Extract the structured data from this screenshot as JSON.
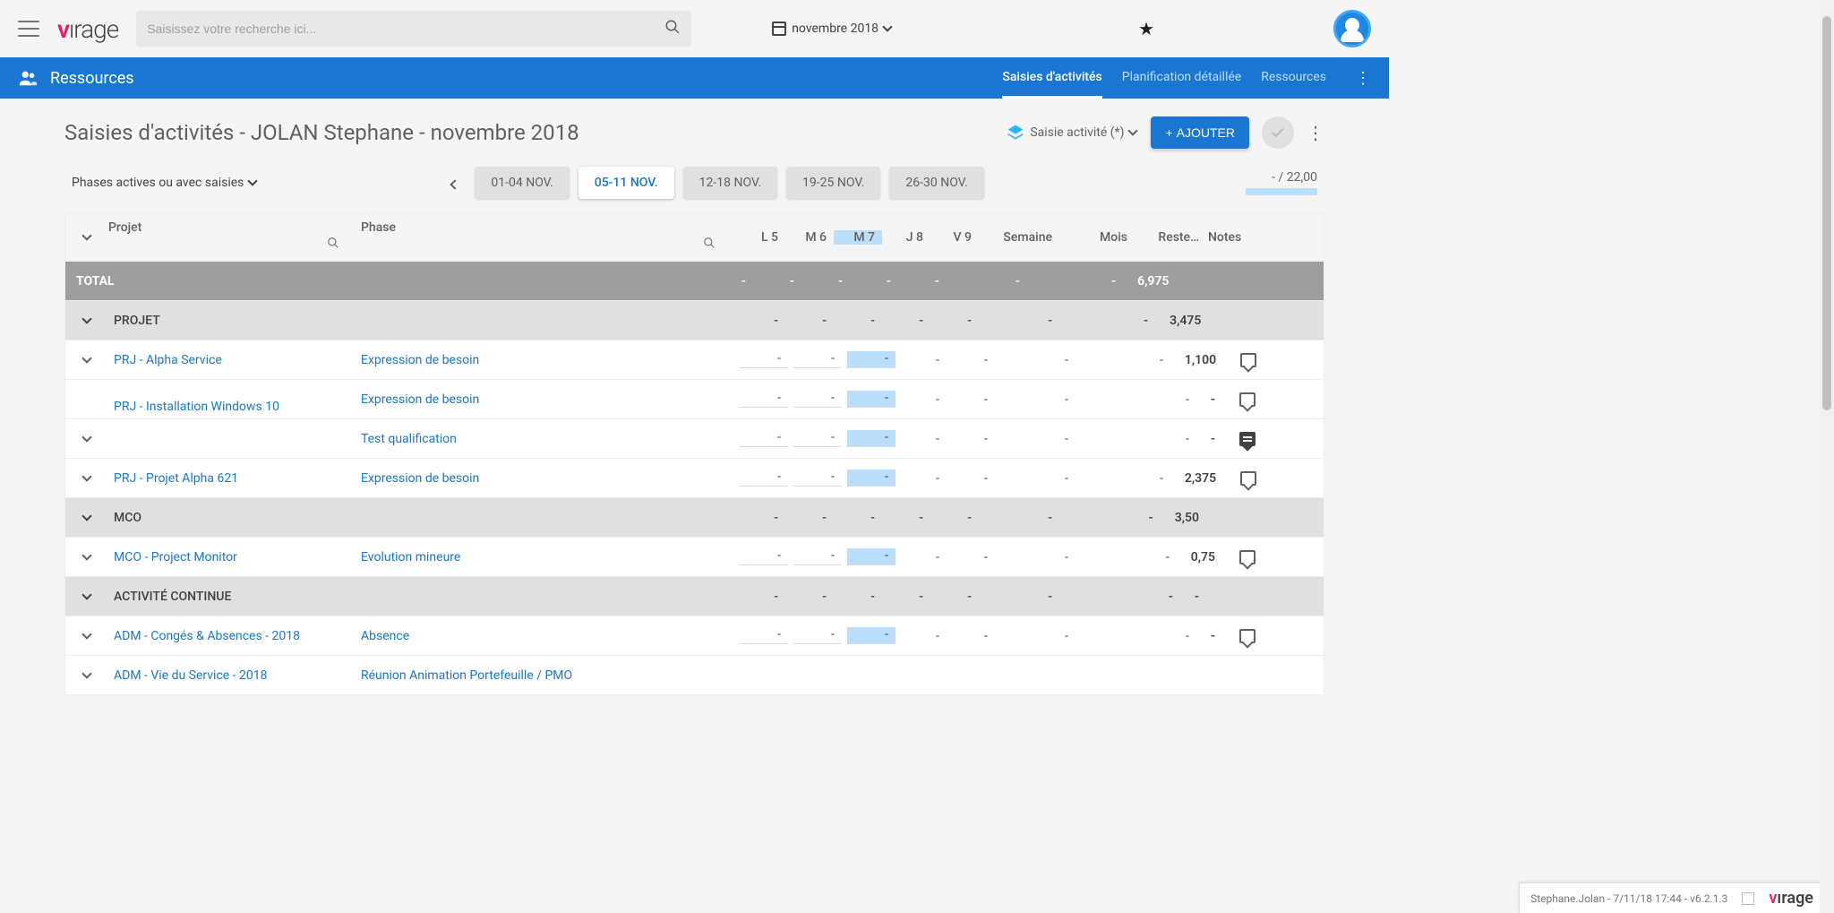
{
  "search": {
    "placeholder": "Saisissez votre recherche ici..."
  },
  "month_picker": "novembre 2018",
  "bluebar": {
    "title": "Ressources",
    "tabs": [
      "Saisies d'activités",
      "Planification détaillée",
      "Ressources"
    ],
    "active_tab": 0
  },
  "page_title": "Saisies d'activités - JOLAN Stephane - novembre 2018",
  "layer_chip": "Saisie activité (*)",
  "add_button": "AJOUTER",
  "phase_filter": "Phases actives ou avec saisies",
  "weeks": [
    "01-04 NOV.",
    "05-11 NOV.",
    "12-18 NOV.",
    "19-25 NOV.",
    "26-30 NOV."
  ],
  "active_week": 1,
  "counter": "- / 22,00",
  "columns": {
    "projet": "Projet",
    "phase": "Phase",
    "days": [
      "L 5",
      "M 6",
      "M 7",
      "J 8",
      "V 9"
    ],
    "highlight_day": 2,
    "semaine": "Semaine",
    "mois": "Mois",
    "reste": "Reste…",
    "notes": "Notes"
  },
  "rows": [
    {
      "type": "total",
      "label": "TOTAL",
      "days": [
        "-",
        "-",
        "-",
        "-",
        "-"
      ],
      "sem": "-",
      "mois": "",
      "reste": "-",
      "alt": "6,975"
    },
    {
      "type": "cat",
      "label": "PROJET",
      "days": [
        "-",
        "-",
        "-",
        "-",
        "-"
      ],
      "sem": "-",
      "mois": "",
      "reste": "-",
      "alt": "3,475"
    },
    {
      "type": "data",
      "projet": "PRJ - Alpha Service",
      "phase": "Expression de besoin",
      "days": [
        "-",
        "-",
        "-",
        "-",
        "-"
      ],
      "sem": "-",
      "mois": "",
      "reste": "-",
      "alt": "1,100",
      "note": "empty"
    },
    {
      "type": "data",
      "projet": "",
      "phase": "Expression de besoin",
      "days": [
        "-",
        "-",
        "-",
        "-",
        "-"
      ],
      "sem": "-",
      "mois": "",
      "reste": "-",
      "alt": "-",
      "note": "empty",
      "group_start": true,
      "group_label": "PRJ - Installation Windows 10"
    },
    {
      "type": "data",
      "projet": "",
      "phase": "Test qualification",
      "days": [
        "-",
        "-",
        "-",
        "-",
        "-"
      ],
      "sem": "-",
      "mois": "",
      "reste": "-",
      "alt": "-",
      "note": "filled",
      "group_end": true
    },
    {
      "type": "data",
      "projet": "PRJ - Projet Alpha 621",
      "phase": "Expression de besoin",
      "days": [
        "-",
        "-",
        "-",
        "-",
        "-"
      ],
      "sem": "-",
      "mois": "",
      "reste": "-",
      "alt": "2,375",
      "note": "empty"
    },
    {
      "type": "cat",
      "label": "MCO",
      "days": [
        "-",
        "-",
        "-",
        "-",
        "-"
      ],
      "sem": "-",
      "mois": "",
      "reste": "-",
      "alt": "3,50"
    },
    {
      "type": "data",
      "projet": "MCO - Project Monitor",
      "phase": "Evolution mineure",
      "days": [
        "-",
        "-",
        "-",
        "-",
        "-"
      ],
      "sem": "-",
      "mois": "",
      "reste": "-",
      "alt": "0,75",
      "note": "empty"
    },
    {
      "type": "cat",
      "label": "ACTIVITÉ CONTINUE",
      "days": [
        "-",
        "-",
        "-",
        "-",
        "-"
      ],
      "sem": "-",
      "mois": "",
      "reste": "-",
      "alt": "-"
    },
    {
      "type": "data",
      "projet": "ADM - Congés & Absences - 2018",
      "phase": "Absence",
      "days": [
        "-",
        "-",
        "-",
        "-",
        "-"
      ],
      "sem": "-",
      "mois": "",
      "reste": "-",
      "alt": "-",
      "note": "empty"
    },
    {
      "type": "data",
      "projet": "ADM - Vie du Service - 2018",
      "phase": "Réunion Animation Portefeuille / PMO",
      "days": [
        "",
        "",
        "",
        "",
        "",
        ""
      ],
      "sem": "",
      "mois": "",
      "reste": "",
      "alt": "",
      "partial": true
    }
  ],
  "status": "Stephane.Jolan - 7/11/18 17:44 - v6.2.1.3"
}
